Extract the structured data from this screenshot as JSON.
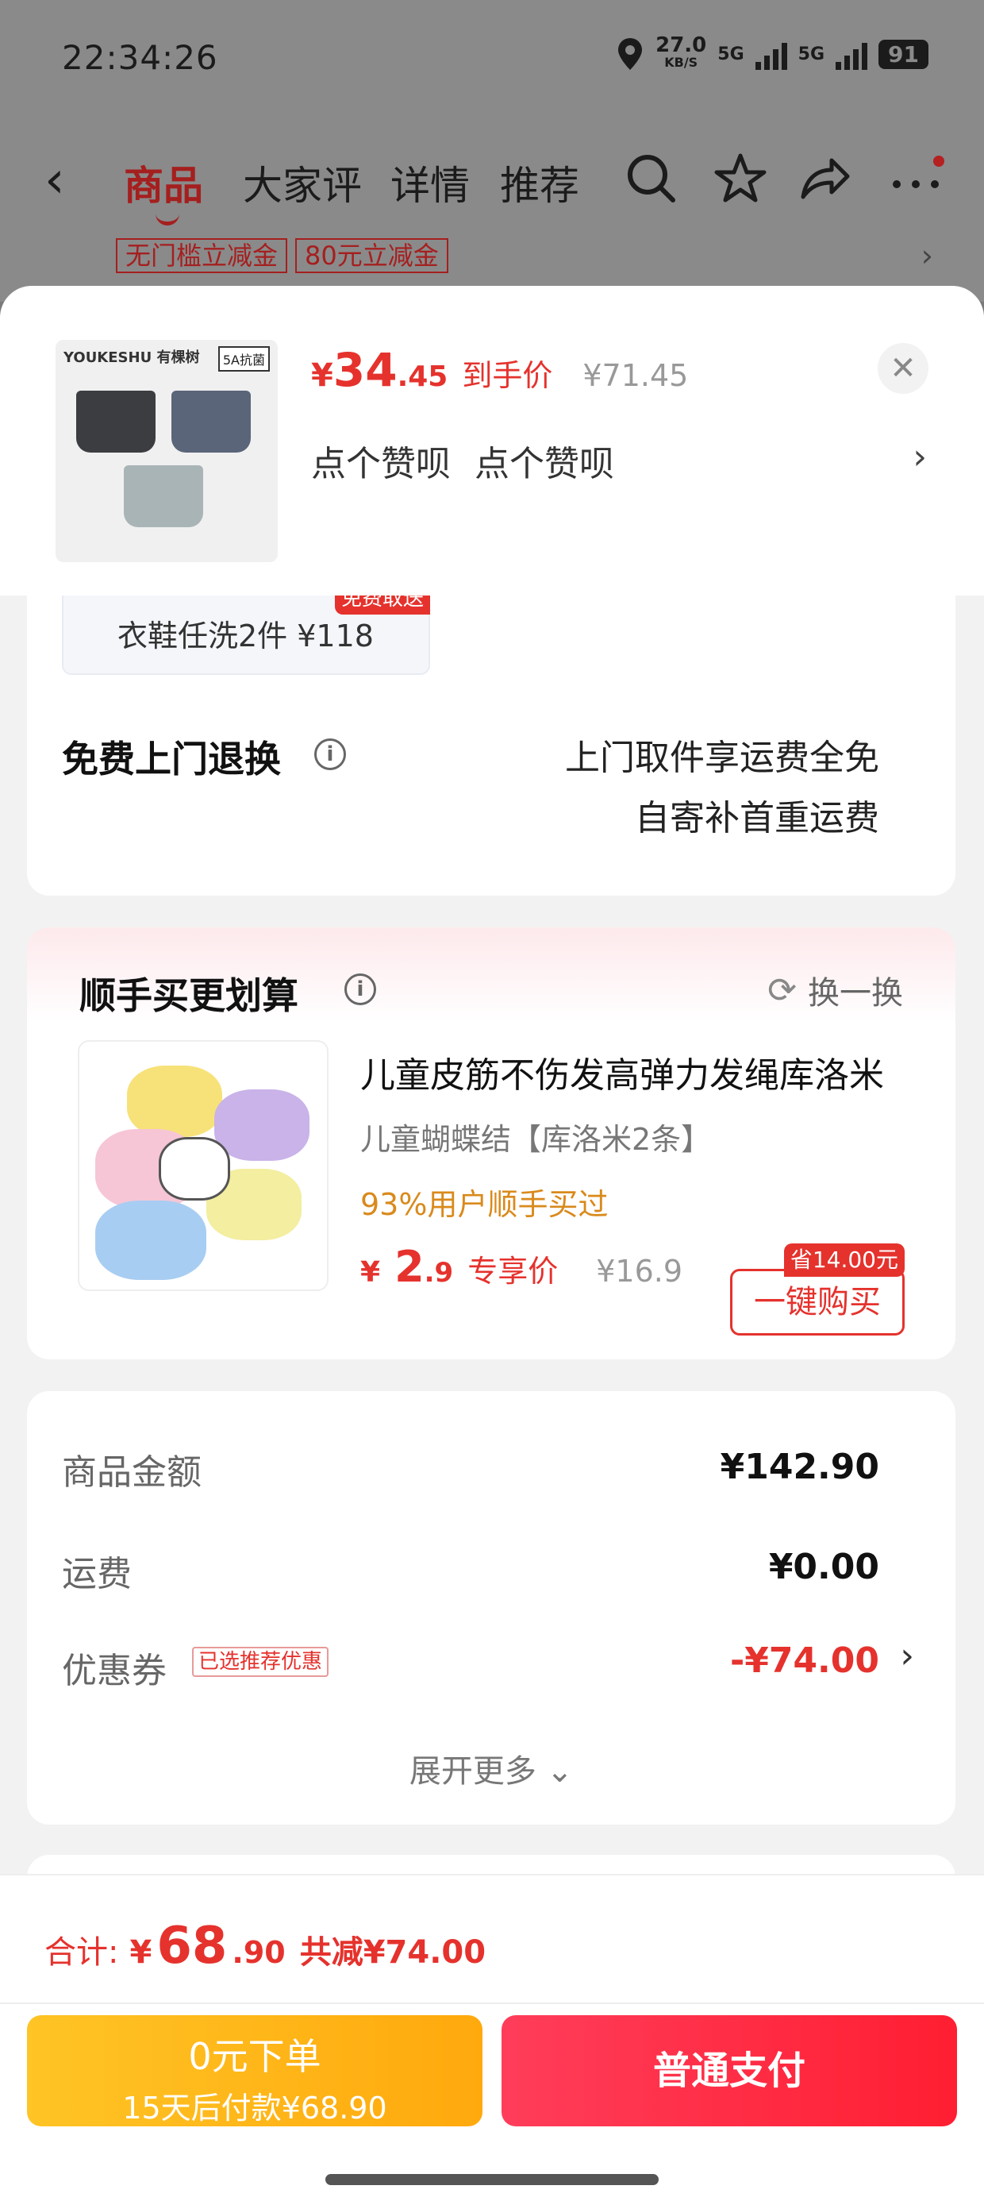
{
  "status_bar": {
    "time": "22:34:26",
    "net_speed": "27.0",
    "net_unit": "KB/S",
    "sig1": "5G",
    "sig2": "5G",
    "battery": "91"
  },
  "nav": {
    "tabs": [
      "商品",
      "大家评",
      "详情",
      "推荐"
    ]
  },
  "coupon_strip": {
    "chip1": "无门槛立减金",
    "chip2": "80元立减金"
  },
  "sheet": {
    "thumb_brand": "YOUKESHU 有棵树",
    "thumb_tag": "5A抗菌",
    "price_currency": "¥",
    "price_int": "34",
    "price_dec": ".45",
    "price_tag": "到手价",
    "price_orig": "¥71.45",
    "spec_1": "点个赞呗",
    "spec_2": "点个赞呗"
  },
  "services": {
    "wash_label": "衣鞋任洗2件  ¥118",
    "wash_badge": "免费取送",
    "return_title": "免费上门退换",
    "return_line1": "上门取件享运费全免",
    "return_line2": "自寄补首重运费"
  },
  "bundle": {
    "title": "顺手买更划算",
    "swap_label": "换一换",
    "name": "儿童皮筋不伤发高弹力发绳库洛米",
    "spec": "儿童蝴蝶结【库洛米2条】",
    "stat": "93%用户顺手买过",
    "price_currency": "¥",
    "price_int": "2",
    "price_dec": ".9",
    "price_tag": "专享价",
    "price_orig": "¥16.9",
    "save_badge": "省14.00元",
    "buy_label": "一键购买"
  },
  "summary": {
    "goods_label": "商品金额",
    "goods_value": "¥142.90",
    "ship_label": "运费",
    "ship_value": "¥0.00",
    "coupon_label": "优惠券",
    "coupon_tag": "已选推荐优惠",
    "coupon_value": "-¥74.00",
    "expand_label": "展开更多"
  },
  "footer": {
    "total_label": "合计:",
    "total_currency": "¥",
    "total_int": "68",
    "total_dec": ".90",
    "total_save": "共减¥74.00",
    "zero_line1": "0元下单",
    "zero_line2": "15天后付款¥68.90",
    "pay_label": "普通支付"
  },
  "colors": {
    "accent_red": "#e5322d",
    "stat_orange": "#d98a1c",
    "zero_btn": "#ffb31a",
    "pay_btn": "#ff2640"
  }
}
